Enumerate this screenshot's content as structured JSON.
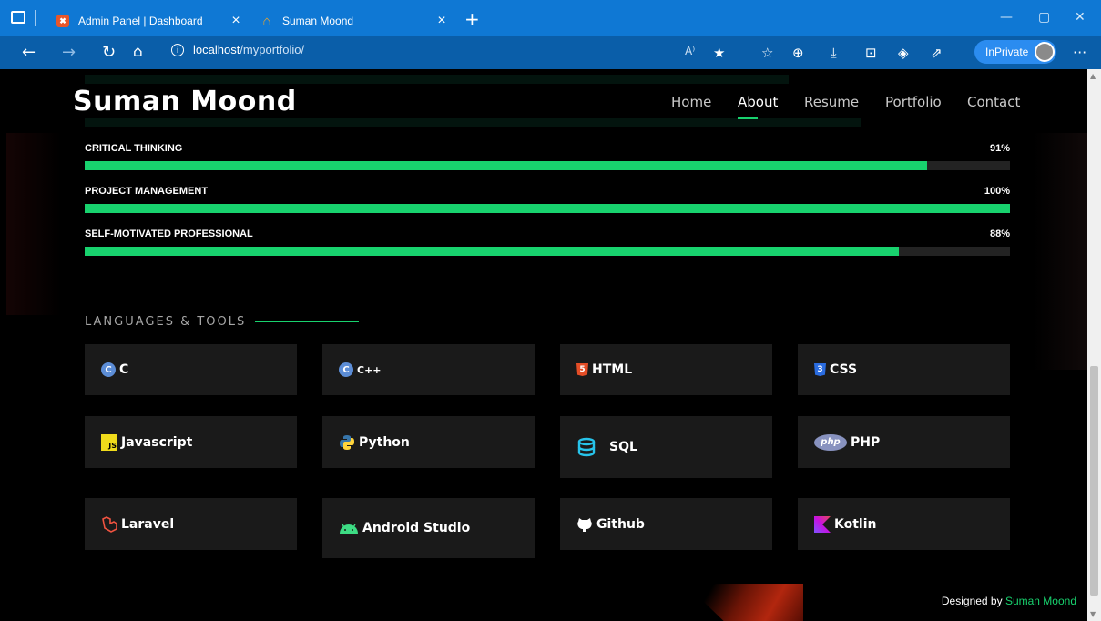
{
  "browser": {
    "tabs": [
      {
        "title": "Admin Panel | Dashboard",
        "favicon": "xampp-icon"
      },
      {
        "title": "Suman Moond",
        "favicon": "house-icon"
      }
    ],
    "url_host": "localhost",
    "url_path": "/myportfolio/",
    "inprivate_label": "InPrivate",
    "accent": "#0f78d4"
  },
  "site": {
    "logo": "Suman Moond",
    "nav": [
      "Home",
      "About",
      "Resume",
      "Portfolio",
      "Contact"
    ],
    "active_nav": "About",
    "accent": "#18d26e"
  },
  "skills": [
    {
      "name": "CRITICAL THINKING",
      "value_label": "91%",
      "fraction": 0.91
    },
    {
      "name": "PROJECT MANAGEMENT",
      "value_label": "100%",
      "fraction": 1.0
    },
    {
      "name": "SELF-MOTIVATED PROFESSIONAL",
      "value_label": "88%",
      "fraction": 0.88
    }
  ],
  "languages": {
    "title": "LANGUAGES & TOOLS",
    "items": [
      {
        "label": "C",
        "icon": "c-icon"
      },
      {
        "label": "C++",
        "icon": "cpp-icon"
      },
      {
        "label": "HTML",
        "icon": "html5-icon"
      },
      {
        "label": "CSS",
        "icon": "css3-icon"
      },
      {
        "label": "Javascript",
        "icon": "js-icon"
      },
      {
        "label": "Python",
        "icon": "python-icon"
      },
      {
        "label": "SQL",
        "icon": "database-icon"
      },
      {
        "label": "PHP",
        "icon": "php-icon"
      },
      {
        "label": "Laravel",
        "icon": "laravel-icon"
      },
      {
        "label": "Android Studio",
        "icon": "android-icon"
      },
      {
        "label": "Github",
        "icon": "github-icon"
      },
      {
        "label": "Kotlin",
        "icon": "kotlin-icon"
      }
    ]
  },
  "footer": {
    "prefix": "Designed by",
    "name": "Suman Moond"
  }
}
